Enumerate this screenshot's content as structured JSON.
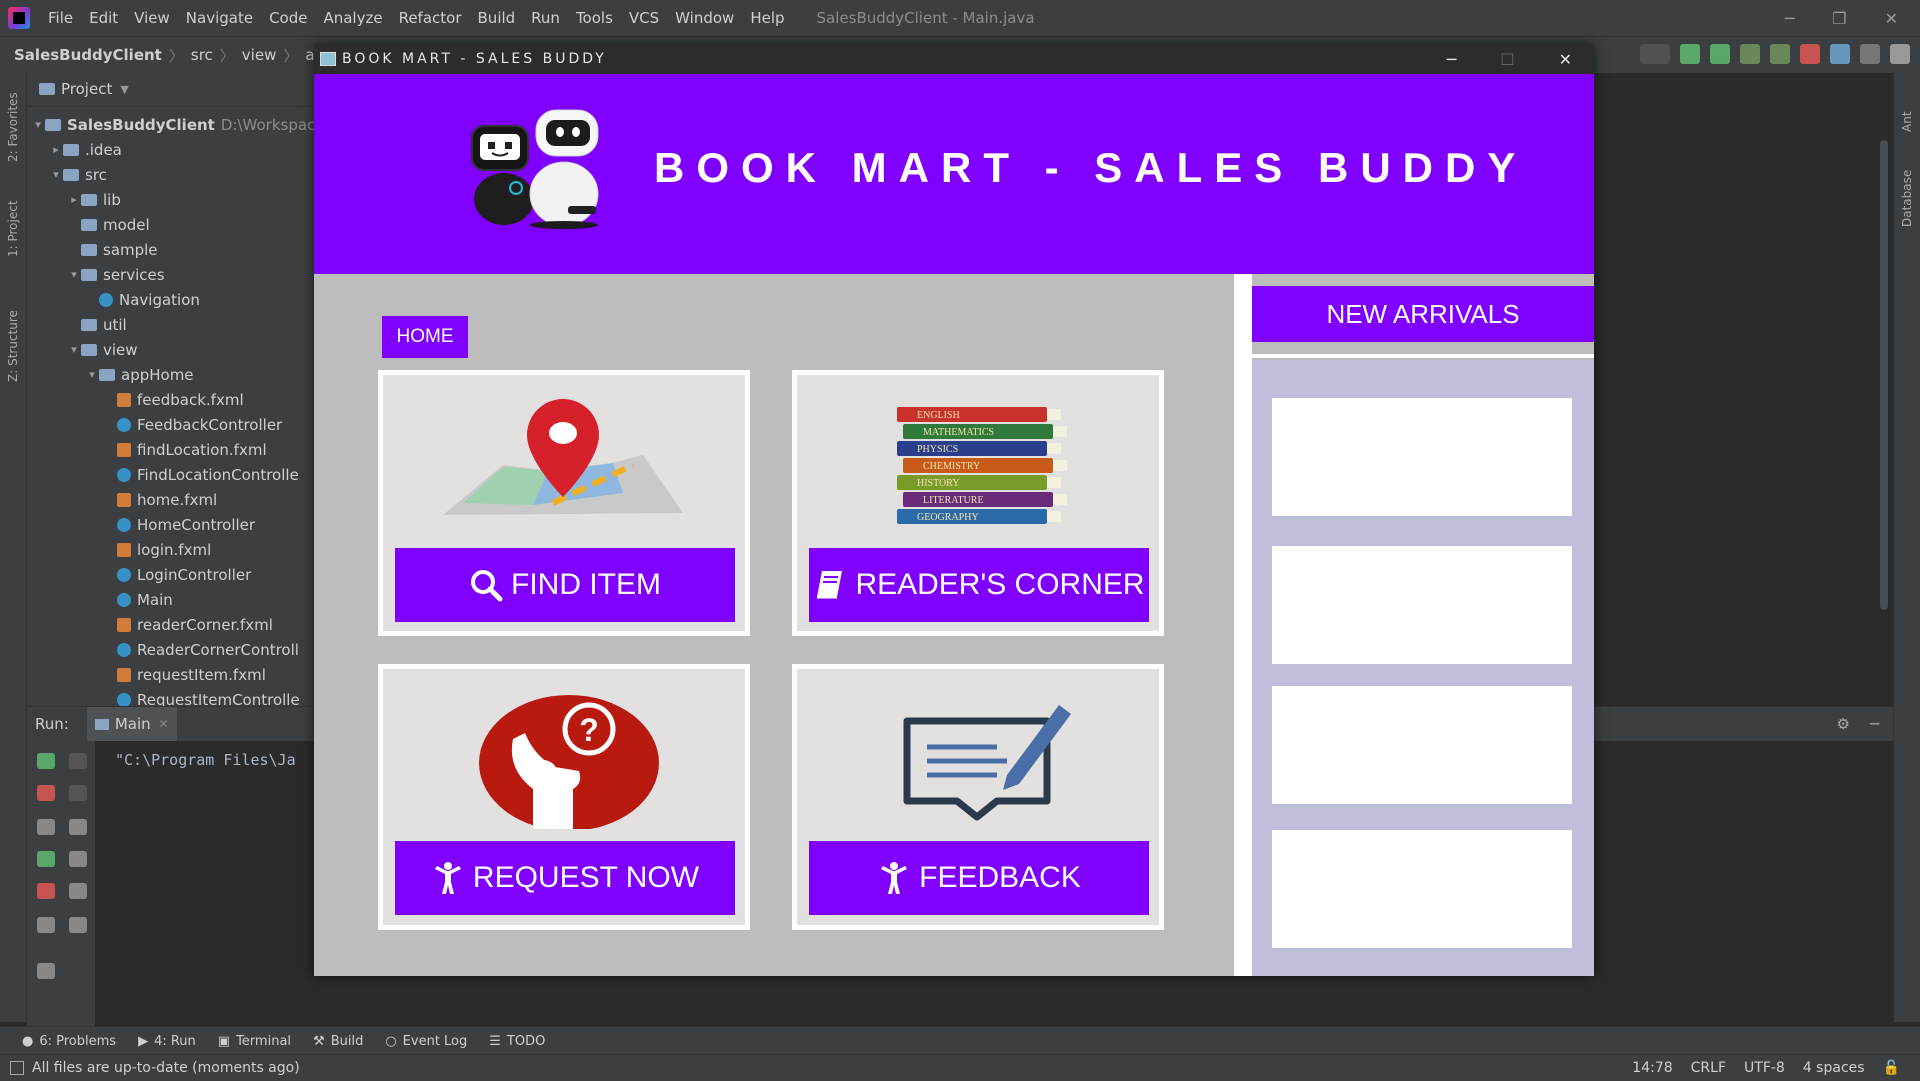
{
  "ide": {
    "menu": [
      "File",
      "Edit",
      "View",
      "Navigate",
      "Code",
      "Analyze",
      "Refactor",
      "Build",
      "Run",
      "Tools",
      "VCS",
      "Window",
      "Help"
    ],
    "window_title": "SalesBuddyClient - Main.java",
    "breadcrumbs": [
      "SalesBuddyClient",
      "src",
      "view",
      "appHome"
    ],
    "left_strip": [
      "2: Favorites",
      "1: Project",
      "Z: Structure"
    ],
    "right_strip": [
      "Ant",
      "Database"
    ],
    "project_header": "Project",
    "tree": [
      {
        "label": "SalesBuddyClient",
        "hint": "D:\\Workspaces\\",
        "icon": "folder",
        "indent": 0,
        "arrow": "▾"
      },
      {
        "label": ".idea",
        "icon": "folder",
        "indent": 1,
        "arrow": "▸"
      },
      {
        "label": "src",
        "icon": "folder",
        "indent": 1,
        "arrow": "▾"
      },
      {
        "label": "lib",
        "icon": "folder",
        "indent": 2,
        "arrow": "▸"
      },
      {
        "label": "model",
        "icon": "folder",
        "indent": 2,
        "arrow": ""
      },
      {
        "label": "sample",
        "icon": "folder",
        "indent": 2,
        "arrow": ""
      },
      {
        "label": "services",
        "icon": "folder",
        "indent": 2,
        "arrow": "▾"
      },
      {
        "label": "Navigation",
        "icon": "class",
        "indent": 3,
        "arrow": ""
      },
      {
        "label": "util",
        "icon": "folder",
        "indent": 2,
        "arrow": ""
      },
      {
        "label": "view",
        "icon": "folder",
        "indent": 2,
        "arrow": "▾"
      },
      {
        "label": "appHome",
        "icon": "folder",
        "indent": 3,
        "arrow": "▾"
      },
      {
        "label": "feedback.fxml",
        "icon": "fxml",
        "indent": 4,
        "arrow": ""
      },
      {
        "label": "FeedbackController",
        "icon": "class",
        "indent": 4,
        "arrow": ""
      },
      {
        "label": "findLocation.fxml",
        "icon": "fxml",
        "indent": 4,
        "arrow": ""
      },
      {
        "label": "FindLocationControlle",
        "icon": "class",
        "indent": 4,
        "arrow": ""
      },
      {
        "label": "home.fxml",
        "icon": "fxml",
        "indent": 4,
        "arrow": ""
      },
      {
        "label": "HomeController",
        "icon": "class",
        "indent": 4,
        "arrow": ""
      },
      {
        "label": "login.fxml",
        "icon": "fxml",
        "indent": 4,
        "arrow": ""
      },
      {
        "label": "LoginController",
        "icon": "class",
        "indent": 4,
        "arrow": ""
      },
      {
        "label": "Main",
        "icon": "class",
        "indent": 4,
        "arrow": ""
      },
      {
        "label": "readerCorner.fxml",
        "icon": "fxml",
        "indent": 4,
        "arrow": ""
      },
      {
        "label": "ReaderCornerControll",
        "icon": "class",
        "indent": 4,
        "arrow": ""
      },
      {
        "label": "requestItem.fxml",
        "icon": "fxml",
        "indent": 4,
        "arrow": ""
      },
      {
        "label": "RequestItemControlle",
        "icon": "class",
        "indent": 4,
        "arrow": ""
      }
    ],
    "run_label": "Run:",
    "run_tab": "Main",
    "console_line": "\"C:\\Program Files\\Ja",
    "bottom_tabs": [
      "6: Problems",
      "4: Run",
      "Terminal",
      "Build",
      "Event Log",
      "TODO"
    ],
    "status_text": "All files are up-to-date (moments ago)",
    "status_right": [
      "14:78",
      "CRLF",
      "UTF-8",
      "4 spaces"
    ]
  },
  "app": {
    "window_title": "BOOK MART - SALES BUDDY",
    "header_title": "BOOK MART - SALES BUDDY",
    "home_button": "HOME",
    "tiles": [
      {
        "label": "FIND ITEM",
        "icon": "search-icon",
        "art": "map-pin-illustration"
      },
      {
        "label": "READER'S CORNER",
        "icon": "book-icon",
        "art": "book-stack-illustration"
      },
      {
        "label": "REQUEST NOW",
        "icon": "person-icon",
        "art": "question-person-illustration"
      },
      {
        "label": "FEEDBACK",
        "icon": "person-icon",
        "art": "feedback-message-illustration"
      }
    ],
    "book_spines": [
      "ENGLISH",
      "MATHEMATICS",
      "PHYSICS",
      "CHEMISTRY",
      "HISTORY",
      "LITERATURE",
      "GEOGRAPHY"
    ],
    "new_arrivals_header": "NEW ARRIVALS",
    "colors": {
      "accent": "#7f00ff",
      "panel_bg": "#bdbdbd",
      "arrivals_bg": "#c0bfdb"
    }
  }
}
